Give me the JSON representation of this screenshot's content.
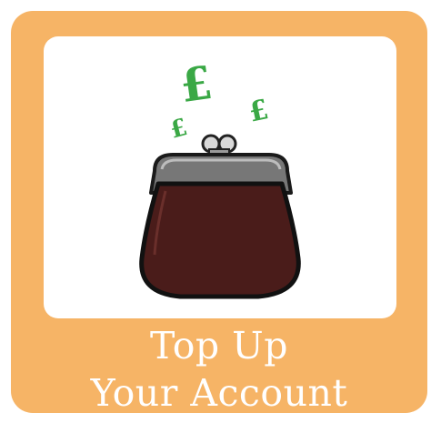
{
  "tile": {
    "label_line1": "Top Up",
    "label_line2": "Your Account",
    "icon": "purse-icon",
    "currency_symbol": "£",
    "colors": {
      "tile_background": "#f6b466",
      "panel_background": "#ffffff",
      "purse_body": "#4a1c1a",
      "purse_frame": "#6f6f6f",
      "pound_symbols": "#3aa845",
      "label_text": "#ffffff"
    }
  }
}
